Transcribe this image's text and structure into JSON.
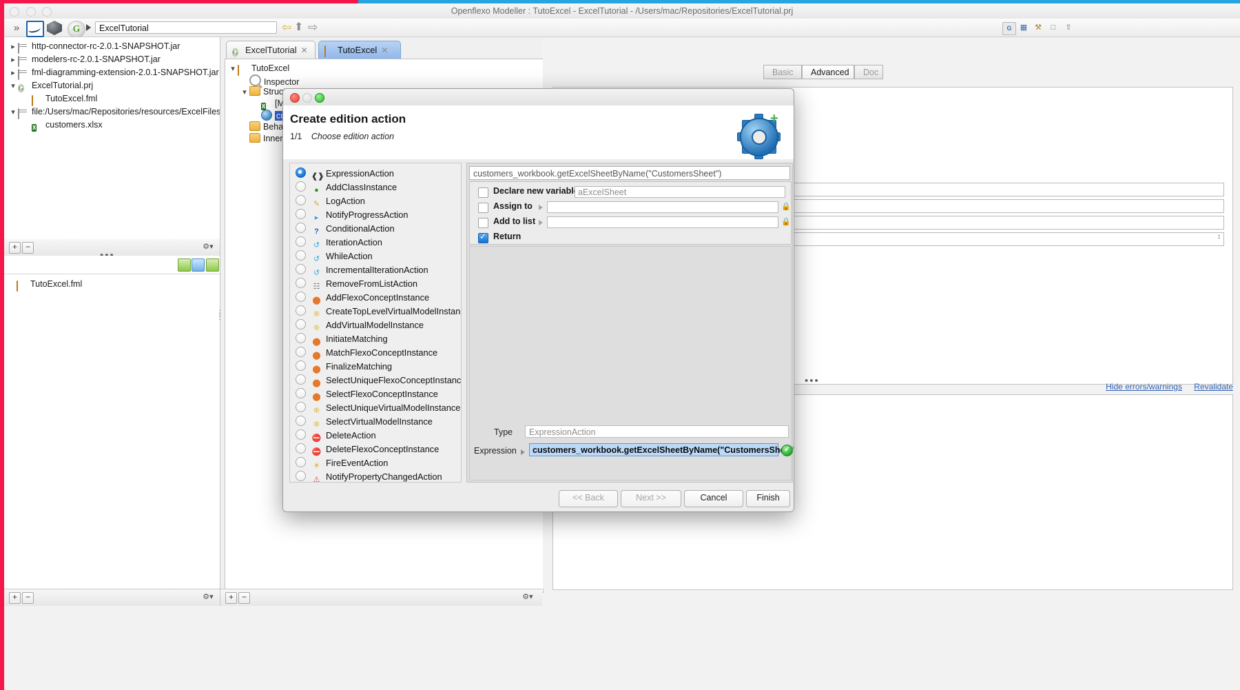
{
  "window": {
    "title": "Openflexo Modeller : TutoExcel - ExcelTutorial - /Users/mac/Repositories/ExcelTutorial.prj"
  },
  "toolbar": {
    "path_value": "ExcelTutorial",
    "chevron_icon": "double-chevron-down-icon",
    "back_icon": "back-arrow-icon",
    "up_icon": "up-arrow-icon",
    "forward_icon": "forward-arrow-icon",
    "right_icons": [
      "grid-icon",
      "table-icon",
      "diagram-icon",
      "window-icon",
      "collapse-icon"
    ]
  },
  "resource_tree": {
    "items": [
      {
        "label": "http-connector-rc-2.0.1-SNAPSHOT.jar",
        "indent": 0,
        "twisty": "collapsed",
        "icon": "jar-icon"
      },
      {
        "label": "modelers-rc-2.0.1-SNAPSHOT.jar",
        "indent": 0,
        "twisty": "collapsed",
        "icon": "jar-icon"
      },
      {
        "label": "fml-diagramming-extension-2.0.1-SNAPSHOT.jar",
        "indent": 0,
        "twisty": "collapsed",
        "icon": "jar-icon"
      },
      {
        "label": "ExcelTutorial.prj",
        "indent": 0,
        "twisty": "expanded",
        "icon": "project-icon"
      },
      {
        "label": "TutoExcel.fml",
        "indent": 1,
        "twisty": "none",
        "icon": "fml-icon"
      },
      {
        "label": "file:/Users/mac/Repositories/resources/ExcelFiles/",
        "indent": 0,
        "twisty": "expanded",
        "icon": "jar-icon"
      },
      {
        "label": "customers.xlsx",
        "indent": 1,
        "twisty": "none",
        "icon": "xlsx-icon"
      }
    ]
  },
  "left_bottom_list": {
    "items": [
      {
        "label": "TutoExcel.fml",
        "icon": "fml-icon"
      }
    ]
  },
  "left_toolbars": {
    "add_label": "+",
    "remove_label": "−",
    "settings_icon": "gear-icon",
    "ellipsis": "•••"
  },
  "editor_tabs": [
    {
      "label": "ExcelTutorial",
      "icon": "project-icon",
      "active": false,
      "close_icon": "close-icon"
    },
    {
      "label": "TutoExcel",
      "icon": "fml-icon",
      "active": true,
      "close_icon": "close-icon"
    }
  ],
  "model_tree": [
    {
      "label": "TutoExcel",
      "indent": 0,
      "twisty": "expanded",
      "icon": "fml-icon",
      "selected": false
    },
    {
      "label": "Inspector",
      "indent": 1,
      "twisty": "none",
      "icon": "magnifier-icon",
      "selected": false
    },
    {
      "label": "Structu",
      "indent": 1,
      "twisty": "expanded",
      "icon": "folder-icon",
      "selected": false
    },
    {
      "label": "[M",
      "indent": 2,
      "twisty": "none",
      "icon": "xlsx-icon",
      "selected": false
    },
    {
      "label": "cu",
      "indent": 2,
      "twisty": "none",
      "icon": "gear-blue-icon",
      "selected": true
    },
    {
      "label": "Behav",
      "indent": 1,
      "twisty": "none",
      "icon": "folder-icon",
      "selected": false
    },
    {
      "label": "Inner",
      "indent": 1,
      "twisty": "none",
      "icon": "folder-icon",
      "selected": false
    }
  ],
  "inspector_tabs": [
    {
      "label": "Basic",
      "active": false
    },
    {
      "label": "Advanced",
      "active": true
    },
    {
      "label": "Doc",
      "active": false
    }
  ],
  "inspector_links": {
    "hide_errors": "Hide errors/warnings",
    "revalidate": "Revalidate"
  },
  "dialog": {
    "title": "Create edition action",
    "step": "1/1",
    "phase": "Choose edition action",
    "icon": "gear-plus-icon",
    "expression_readout": "customers_workbook.getExcelSheetByName(\"CustomersSheet\")",
    "options": [
      {
        "label": "Declare new variable",
        "checked": false,
        "value": "",
        "placeholder": "aExcelSheet",
        "has_arrow": false,
        "has_lock": false
      },
      {
        "label": "Assign to",
        "checked": false,
        "value": "",
        "placeholder": "",
        "has_arrow": true,
        "has_lock": true
      },
      {
        "label": "Add to list",
        "checked": false,
        "value": "",
        "placeholder": "",
        "has_arrow": true,
        "has_lock": true
      },
      {
        "label": "Return",
        "checked": true,
        "value": "",
        "placeholder": "",
        "has_arrow": false,
        "has_lock": false
      }
    ],
    "type_label": "Type",
    "type_value": "ExpressionAction",
    "expression_label": "Expression",
    "expression_value": "customers_workbook.getExcelSheetByName(\"CustomersSheet\")",
    "validation_icon": "check-circle-icon",
    "actions": [
      {
        "label": "ExpressionAction",
        "icon": "expression-icon",
        "selected": true
      },
      {
        "label": "AddClassInstance",
        "icon": "add-class-icon",
        "selected": false
      },
      {
        "label": "LogAction",
        "icon": "pencil-icon",
        "selected": false
      },
      {
        "label": "NotifyProgressAction",
        "icon": "play-icon",
        "selected": false
      },
      {
        "label": "ConditionalAction",
        "icon": "question-icon",
        "selected": false
      },
      {
        "label": "IterationAction",
        "icon": "loop-icon",
        "selected": false
      },
      {
        "label": "WhileAction",
        "icon": "loop-icon",
        "selected": false
      },
      {
        "label": "IncrementalIterationAction",
        "icon": "loop-icon",
        "selected": false
      },
      {
        "label": "RemoveFromListAction",
        "icon": "list-remove-icon",
        "selected": false
      },
      {
        "label": "AddFlexoConceptInstance",
        "icon": "concept-icon",
        "selected": false
      },
      {
        "label": "CreateTopLevelVirtualModelInstance",
        "icon": "virtual-model-icon",
        "selected": false
      },
      {
        "label": "AddVirtualModelInstance",
        "icon": "virtual-model-icon",
        "selected": false
      },
      {
        "label": "InitiateMatching",
        "icon": "matching-icon",
        "selected": false
      },
      {
        "label": "MatchFlexoConceptInstance",
        "icon": "matching-icon",
        "selected": false
      },
      {
        "label": "FinalizeMatching",
        "icon": "matching-icon",
        "selected": false
      },
      {
        "label": "SelectUniqueFlexoConceptInstance",
        "icon": "select-concept-icon",
        "selected": false
      },
      {
        "label": "SelectFlexoConceptInstance",
        "icon": "select-concept-icon",
        "selected": false
      },
      {
        "label": "SelectUniqueVirtualModelInstance",
        "icon": "select-vm-icon",
        "selected": false
      },
      {
        "label": "SelectVirtualModelInstance",
        "icon": "select-vm-icon",
        "selected": false
      },
      {
        "label": "DeleteAction",
        "icon": "delete-icon",
        "selected": false
      },
      {
        "label": "DeleteFlexoConceptInstance",
        "icon": "delete-icon",
        "selected": false
      },
      {
        "label": "FireEventAction",
        "icon": "event-icon",
        "selected": false
      },
      {
        "label": "NotifyPropertyChangedAction",
        "icon": "notify-icon",
        "selected": false
      }
    ],
    "buttons": [
      {
        "label": "<< Back",
        "enabled": false
      },
      {
        "label": "Next >>",
        "enabled": false
      },
      {
        "label": "Cancel",
        "enabled": true
      },
      {
        "label": "Finish",
        "enabled": true
      }
    ]
  },
  "colors": {
    "accent_pink": "#f5164b",
    "accent_blue": "#27a5e0",
    "selection_blue": "#2f63d8",
    "tab_active": "#8fb8ec",
    "expr_highlight": "#bcd9f7"
  }
}
